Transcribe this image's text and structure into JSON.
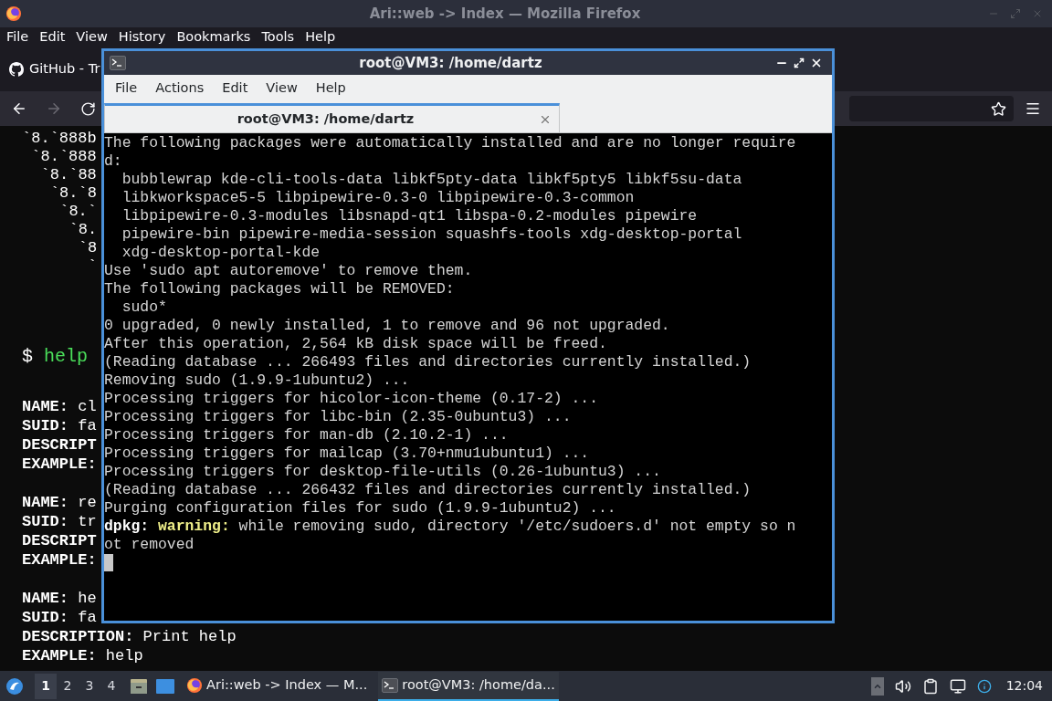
{
  "browser": {
    "title": "Ari::web -> Index — Mozilla Firefox",
    "menu": [
      "File",
      "Edit",
      "View",
      "History",
      "Bookmarks",
      "Tools",
      "Help"
    ],
    "tab": {
      "title": "GitHub - Tr"
    },
    "nav": {
      "forward_disabled": true
    },
    "content": {
      "art": [
        "`8.`888b",
        "`8.`888",
        "`8.`88",
        "`8.`8",
        "`8.`",
        "`8.",
        "`8",
        "`"
      ],
      "prompt": {
        "symbol": "$",
        "command": "help"
      },
      "entries": [
        {
          "fields": [
            "**NAME:** cl",
            "**SUID:** fa",
            "**DESCRIPT**",
            "**EXAMPLE:**"
          ]
        },
        {
          "fields": [
            "**NAME:** re",
            "**SUID:** tr",
            "**DESCRIPT**",
            "**EXAMPLE:**"
          ]
        },
        {
          "fields": [
            "**NAME:** he",
            "**SUID:** fa",
            "**DESCRIPTION:** Print help",
            "**EXAMPLE:** help"
          ]
        }
      ]
    }
  },
  "terminal": {
    "title": "root@VM3: /home/dartz",
    "menu": [
      "File",
      "Actions",
      "Edit",
      "View",
      "Help"
    ],
    "tab": {
      "title": "root@VM3: /home/dartz",
      "selected": true
    },
    "lines": [
      [
        {
          "text": "The following packages were automatically installed and are no longer require",
          "kind": "plain"
        }
      ],
      [
        {
          "text": "d:",
          "kind": "plain"
        }
      ],
      [
        {
          "text": "  bubblewrap kde-cli-tools-data libkf5pty-data libkf5pty5 libkf5su-data",
          "kind": "plain"
        }
      ],
      [
        {
          "text": "  libkworkspace5-5 libpipewire-0.3-0 libpipewire-0.3-common",
          "kind": "plain"
        }
      ],
      [
        {
          "text": "  libpipewire-0.3-modules libsnapd-qt1 libspa-0.2-modules pipewire",
          "kind": "plain"
        }
      ],
      [
        {
          "text": "  pipewire-bin pipewire-media-session squashfs-tools xdg-desktop-portal",
          "kind": "plain"
        }
      ],
      [
        {
          "text": "  xdg-desktop-portal-kde",
          "kind": "plain"
        }
      ],
      [
        {
          "text": "Use 'sudo apt autoremove' to remove them.",
          "kind": "plain"
        }
      ],
      [
        {
          "text": "The following packages will be REMOVED:",
          "kind": "plain"
        }
      ],
      [
        {
          "text": "  sudo*",
          "kind": "plain"
        }
      ],
      [
        {
          "text": "0 upgraded, 0 newly installed, 1 to remove and 96 not upgraded.",
          "kind": "plain"
        }
      ],
      [
        {
          "text": "After this operation, 2,564 kB disk space will be freed.",
          "kind": "plain"
        }
      ],
      [
        {
          "text": "(Reading database ... 266493 files and directories currently installed.)",
          "kind": "plain"
        }
      ],
      [
        {
          "text": "Removing sudo (1.9.9-1ubuntu2) ...",
          "kind": "plain"
        }
      ],
      [
        {
          "text": "Processing triggers for hicolor-icon-theme (0.17-2) ...",
          "kind": "plain"
        }
      ],
      [
        {
          "text": "Processing triggers for libc-bin (2.35-0ubuntu3) ...",
          "kind": "plain"
        }
      ],
      [
        {
          "text": "Processing triggers for man-db (2.10.2-1) ...",
          "kind": "plain"
        }
      ],
      [
        {
          "text": "Processing triggers for mailcap (3.70+nmu1ubuntu1) ...",
          "kind": "plain"
        }
      ],
      [
        {
          "text": "Processing triggers for desktop-file-utils (0.26-1ubuntu3) ...",
          "kind": "plain"
        }
      ],
      [
        {
          "text": "(Reading database ... 266432 files and directories currently installed.)",
          "kind": "plain"
        }
      ],
      [
        {
          "text": "Purging configuration files for sudo (1.9.9-1ubuntu2) ...",
          "kind": "plain"
        }
      ],
      [
        {
          "text": "dpkg:",
          "kind": "bold"
        },
        {
          "text": " warning:",
          "kind": "warning"
        },
        {
          "text": " while removing sudo, directory '/etc/sudoers.d' not empty so n",
          "kind": "plain"
        }
      ],
      [
        {
          "text": "ot removed",
          "kind": "plain"
        }
      ]
    ],
    "cursor": true
  },
  "taskbar": {
    "workspaces": [
      {
        "label": "1",
        "selected": true
      },
      {
        "label": "2",
        "selected": false
      },
      {
        "label": "3",
        "selected": false
      },
      {
        "label": "4",
        "selected": false
      }
    ],
    "tasks": [
      {
        "title": "Ari::web -> Index — M...",
        "kind": "browser",
        "selected": false
      },
      {
        "title": "root@VM3: /home/da...",
        "kind": "terminal",
        "selected": true
      }
    ],
    "clock": "12:04"
  }
}
